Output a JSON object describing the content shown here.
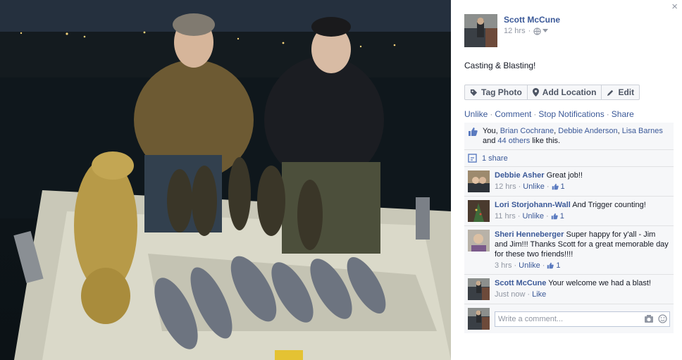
{
  "post": {
    "author": "Scott McCune",
    "time": "12 hrs",
    "privacy_icon": "globe-icon",
    "text": "Casting & Blasting!"
  },
  "close_label": "×",
  "actions": {
    "tag_photo": "Tag Photo",
    "add_location": "Add Location",
    "edit": "Edit"
  },
  "links": {
    "unlike": "Unlike",
    "comment": "Comment",
    "stop_notifications": "Stop Notifications",
    "share": "Share",
    "separator": "·"
  },
  "likes": {
    "prefix": "You, ",
    "names": [
      "Brian Cochrane",
      "Debbie Anderson",
      "Lisa Barnes"
    ],
    "and": "and ",
    "others": "44 others",
    "suffix": " like this."
  },
  "shares": "1 share",
  "comments": [
    {
      "name": "Debbie Asher",
      "text": "Great job!!",
      "time": "12 hrs",
      "unlike": "Unlike",
      "likes": "1"
    },
    {
      "name": "Lori Storjohann-Wall",
      "text": "And Trigger counting!",
      "time": "11 hrs",
      "unlike": "Unlike",
      "likes": "1"
    },
    {
      "name": "Sheri Henneberger",
      "text": "Super happy for y'all - Jim and Jim!!! Thanks Scott for a great memorable day for these two friends!!!!",
      "time": "3 hrs",
      "unlike": "Unlike",
      "likes": "1"
    },
    {
      "name": "Scott McCune",
      "text": "Your welcome we had a blast!",
      "time": "Just now",
      "like": "Like"
    }
  ],
  "composer": {
    "placeholder": "Write a comment..."
  },
  "colors": {
    "link": "#3b5998",
    "muted": "#9197a3",
    "panel": "#f6f7f9"
  }
}
